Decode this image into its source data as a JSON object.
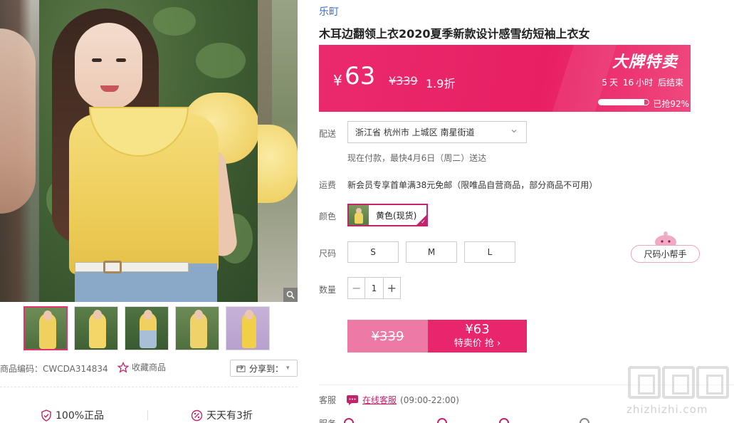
{
  "brand": "乐町",
  "product_title": "木耳边翻领上衣2020夏季新款设计感雪纺短袖上衣女",
  "price": {
    "currency": "¥",
    "sale": "63",
    "original": "¥339",
    "discount": "1.9折",
    "badge": "大牌特卖",
    "countdown": {
      "days": "5",
      "days_unit": "天",
      "hours": "16",
      "hours_unit": "小时",
      "end_text": "后结束"
    },
    "sold_percent": 0.92,
    "sold_text": "已抢92%",
    "accent": "#e81f63"
  },
  "delivery": {
    "label": "配送",
    "address": "浙江省 杭州市 上城区 南星街道",
    "note": "现在付款，最快4月6日（周二）送达"
  },
  "shipping": {
    "label": "运费",
    "note": "新会员专享首单满38元免邮（限唯品自营商品，部分商品不可用）"
  },
  "color": {
    "label": "颜色",
    "selected": "黄色(现货)"
  },
  "size": {
    "label": "尺码",
    "options": [
      "S",
      "M",
      "L"
    ],
    "helper": "尺码小帮手"
  },
  "quantity": {
    "label": "数量",
    "value": "1",
    "minus": "−",
    "plus": "+"
  },
  "buy": {
    "original": "¥339",
    "price": "¥63",
    "label": "特卖价 抢",
    "arrow": "›"
  },
  "service": {
    "label": "客服",
    "link": "在线客服",
    "hours": "(09:00-22:00)"
  },
  "services_row": {
    "label": "服务"
  },
  "gallery": {
    "thumbnail_count": 5,
    "active_index": 0
  },
  "meta": {
    "sku": "商品编码：CWCDA314834",
    "favorite": "收藏商品",
    "share": "分享到："
  },
  "guarantee": {
    "item1": "100%正品",
    "item2": "天天有3折"
  },
  "watermark": {
    "url": "zhizhizhi.com"
  }
}
